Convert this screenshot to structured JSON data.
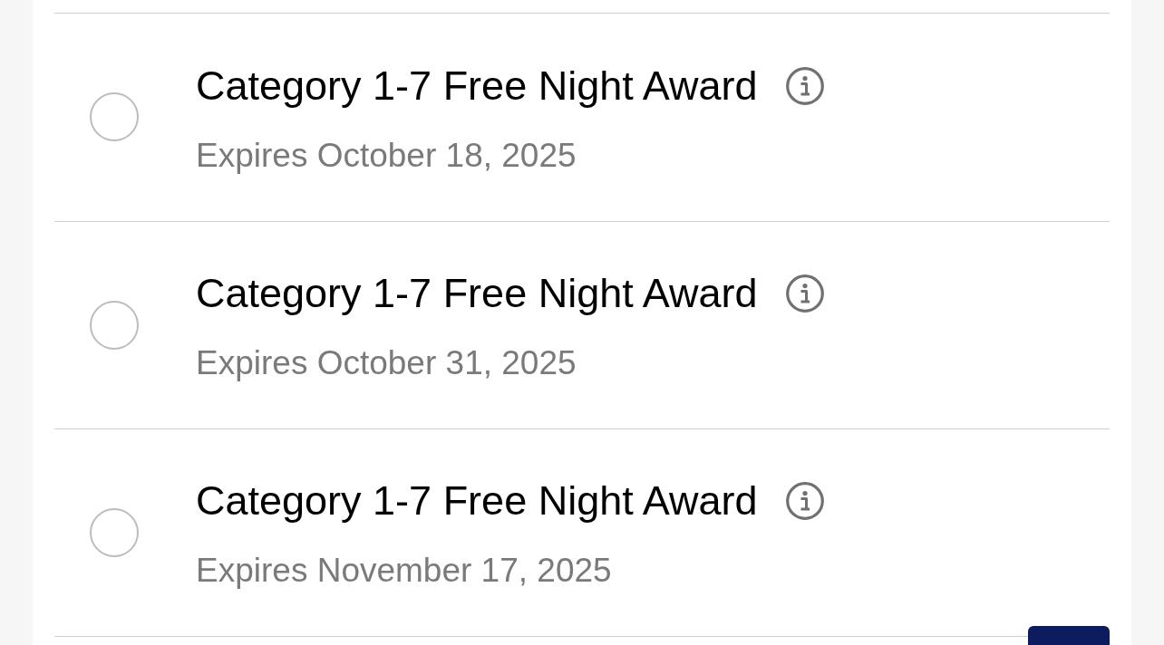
{
  "awards": [
    {
      "title": "Category 1-7 Free Night Award",
      "expiry": "Expires October 18, 2025",
      "selected": false
    },
    {
      "title": "Category 1-7 Free Night Award",
      "expiry": "Expires October 31, 2025",
      "selected": false
    },
    {
      "title": "Category 1-7 Free Night Award",
      "expiry": "Expires November 17, 2025",
      "selected": false
    }
  ]
}
